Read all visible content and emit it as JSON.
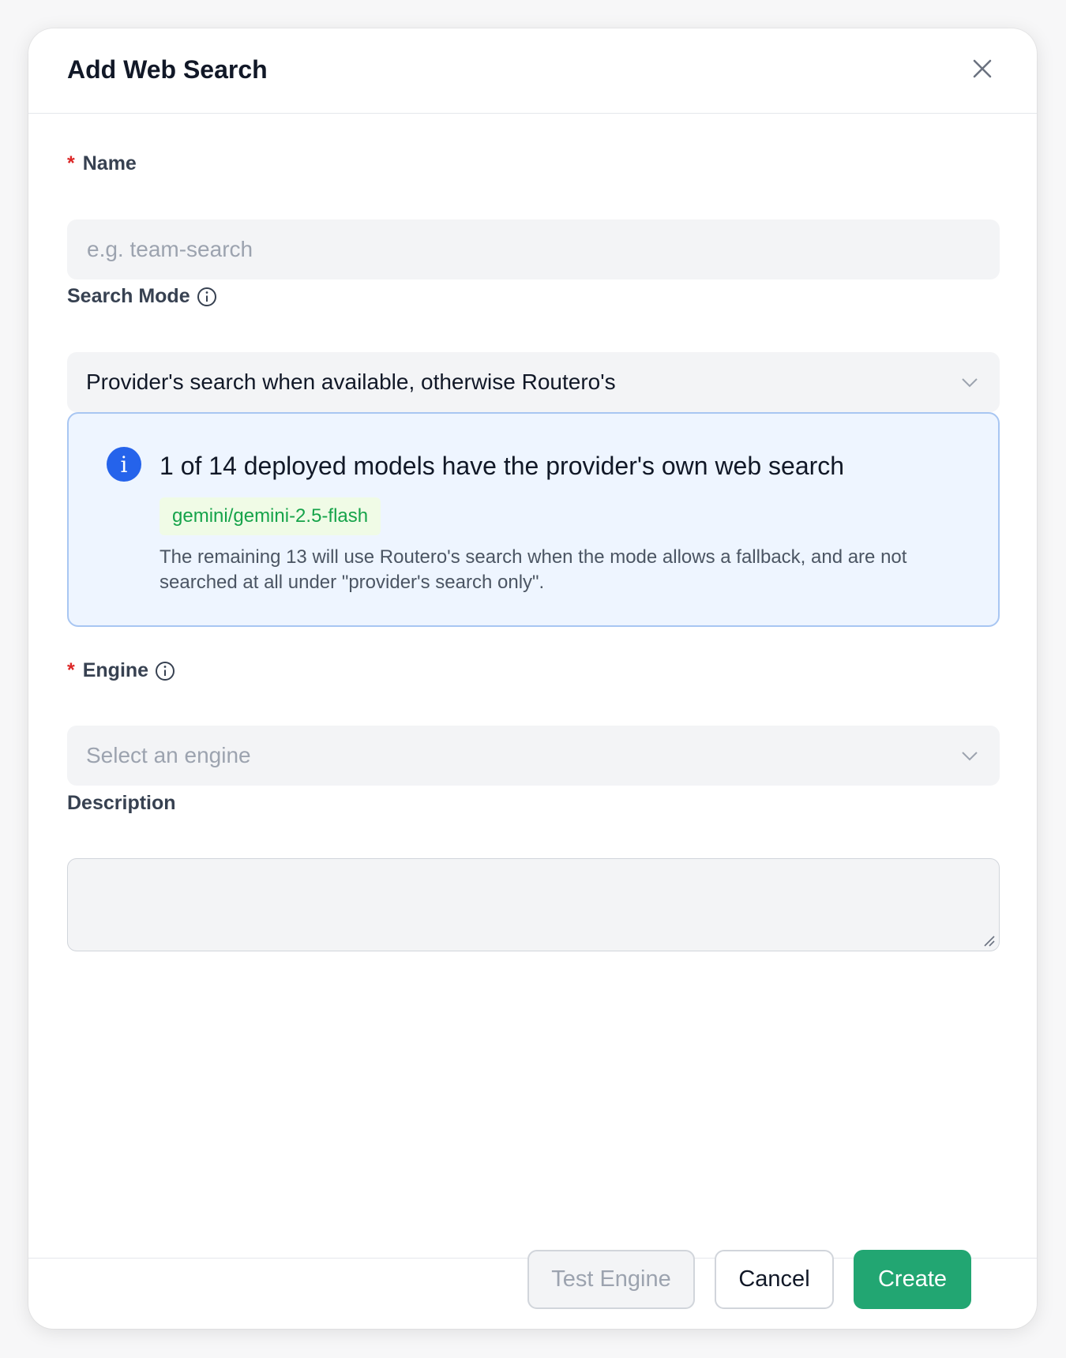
{
  "dialog": {
    "title": "Add Web Search",
    "close_icon": "close-icon"
  },
  "fields": {
    "name": {
      "label": "Name",
      "required_mark": "*",
      "placeholder": "e.g. team-search"
    },
    "search_mode": {
      "label": "Search Mode",
      "value": "Provider's search when available, otherwise Routero's"
    },
    "engine": {
      "label": "Engine",
      "required_mark": "*",
      "placeholder": "Select an engine"
    },
    "description": {
      "label": "Description",
      "value": ""
    }
  },
  "notice": {
    "title": "1 of 14 deployed models have the provider's own web search",
    "model_tag": "gemini/gemini-2.5-flash",
    "body": "The remaining 13 will use Routero's search when the mode allows a fallback, and are not searched at all under \"provider's search only\".",
    "icon_glyph": "i"
  },
  "footer": {
    "test_label": "Test Engine",
    "cancel_label": "Cancel",
    "create_label": "Create"
  },
  "colors": {
    "primary": "#22a672",
    "info": "#2563eb",
    "required": "#dc2626",
    "tag_text": "#16a34a"
  }
}
